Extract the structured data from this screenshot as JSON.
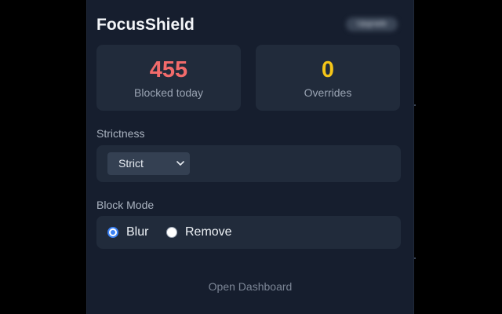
{
  "app": {
    "title": "FocusShield",
    "status_pill": "Upgrade"
  },
  "stats": [
    {
      "value": "455",
      "label": "Blocked today",
      "color": "#f26b6b"
    },
    {
      "value": "0",
      "label": "Overrides",
      "color": "#f5c518"
    }
  ],
  "strictness": {
    "label": "Strictness",
    "selected": "Strict",
    "icon": "chevron-down-icon"
  },
  "block_mode": {
    "label": "Block Mode",
    "options": [
      {
        "label": "Blur",
        "checked": true
      },
      {
        "label": "Remove",
        "checked": false
      }
    ],
    "accent": "#3b82f6"
  },
  "footer": {
    "link": "Open Dashboard"
  }
}
